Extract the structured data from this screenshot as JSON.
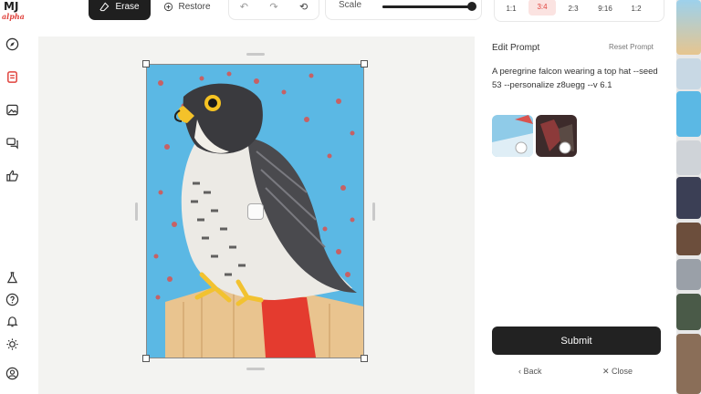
{
  "app": {
    "logo_main": "MJ",
    "logo_sub": "alpha"
  },
  "toolbar": {
    "erase_label": "Erase",
    "restore_label": "Restore",
    "scale_label": "Scale",
    "scale_value": 0.98
  },
  "ratios": {
    "options": [
      "1:1",
      "3:4",
      "2:3",
      "9:16",
      "1:2"
    ],
    "selected": "3:4"
  },
  "panel": {
    "title": "Edit Prompt",
    "reset_label": "Reset Prompt",
    "prompt": "A peregrine falcon wearing a top hat --seed 53 --personalize z8uegg --v 6.1",
    "submit_label": "Submit",
    "back_label": "‹ Back",
    "close_label": "✕ Close"
  },
  "colors": {
    "accent": "#e0443e",
    "dark": "#1f1f1f"
  }
}
